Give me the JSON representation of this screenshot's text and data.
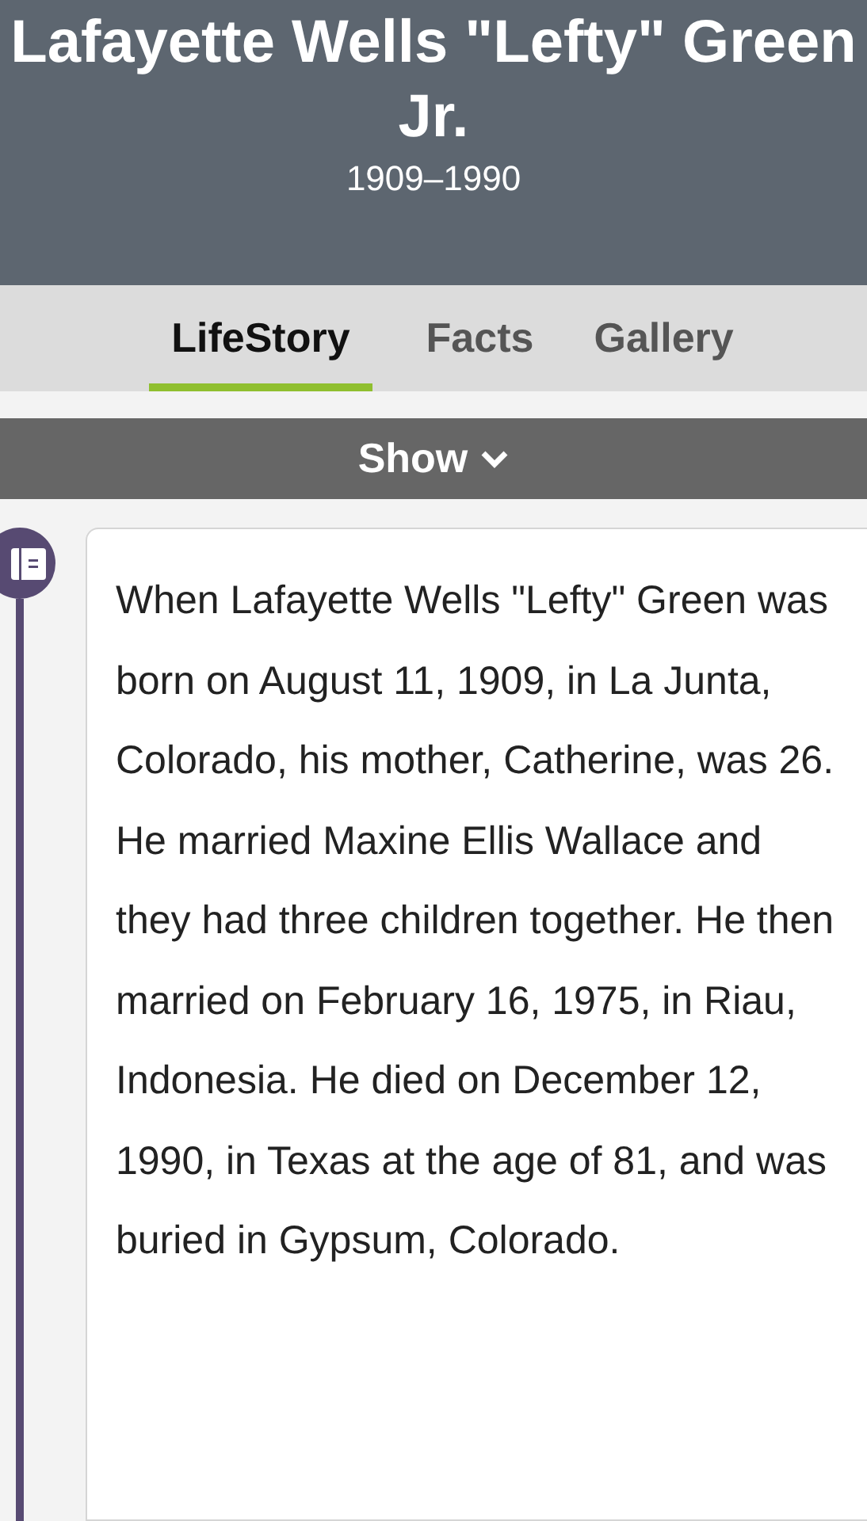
{
  "header": {
    "name": "Lafayette Wells \"Lefty\" Green Jr.",
    "lifespan": "1909–1990"
  },
  "tabs": [
    {
      "label": "LifeStory",
      "selected": true
    },
    {
      "label": "Facts",
      "selected": false
    },
    {
      "label": "Gallery",
      "selected": false
    }
  ],
  "show_button": {
    "label": "Show",
    "expanded": false
  },
  "story": {
    "text": "When Lafayette Wells \"Lefty\" Green was born on August 11, 1909, in La Junta, Colorado, his mother, Catherine, was 26. He married Maxine Ellis Wallace and they had three children together. He then married on February 16, 1975, in Riau, Indonesia. He died on December 12, 1990, in Texas at the age of 81, and was buried in Gypsum, Colorado."
  }
}
